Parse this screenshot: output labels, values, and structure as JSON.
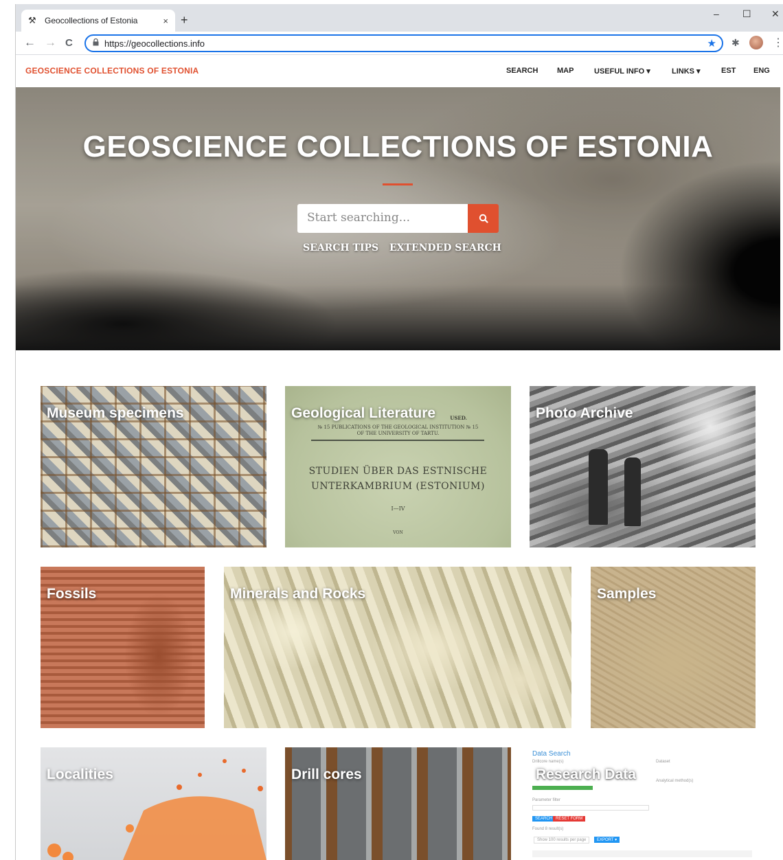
{
  "browser": {
    "tab_title": "Geocollections of Estonia",
    "tab_close": "×",
    "new_tab": "+",
    "url": "https://geocollections.info",
    "win_min": "–",
    "win_max": "☐",
    "win_close": "✕",
    "nav_back": "←",
    "nav_forward": "→",
    "nav_reload": "C",
    "menu_dots": "⋮"
  },
  "site": {
    "brand": "GEOSCIENCE COLLECTIONS OF ESTONIA",
    "nav": [
      "SEARCH",
      "MAP",
      "USEFUL INFO ▾",
      "LINKS ▾",
      "EST",
      "ENG"
    ]
  },
  "hero": {
    "title": "GEOSCIENCE COLLECTIONS OF ESTONIA",
    "search_placeholder": "Start searching...",
    "links": [
      "SEARCH TIPS",
      "EXTENDED SEARCH"
    ]
  },
  "tiles": [
    {
      "label": "Museum specimens"
    },
    {
      "label": "Geological Literature"
    },
    {
      "label": "Photo Archive"
    },
    {
      "label": "Fossils"
    },
    {
      "label": "Minerals and Rocks"
    },
    {
      "label": "Samples"
    },
    {
      "label": "Localities"
    },
    {
      "label": "Drill cores"
    },
    {
      "label": "Research Data"
    }
  ],
  "literature_cover": {
    "top": "USED.",
    "pub": "№ 15   PUBLICATIONS OF THE GEOLOGICAL INSTITUTION   № 15",
    "pub2": "OF THE UNIVERSITY OF TARTU.",
    "title1": "STUDIEN ÜBER DAS ESTNISCHE",
    "title2": "UNTERKAMBRIUM (ESTONIUM)",
    "vol": "I—IV",
    "von": "VON"
  },
  "research_preview": {
    "heading": "Data Search",
    "dataset": "Dataset",
    "drillcore": "Drillcore name(s)",
    "analytical": "Analytical method(s)",
    "parameter": "Parameter filter",
    "search": "SEARCH",
    "reset": "RESET FORM",
    "found": "Found 8 result(s)",
    "show": "Show 100 results per page",
    "export": "EXPORT ▾"
  },
  "colors": {
    "accent": "#e0502f",
    "link_blue": "#1a73e8"
  }
}
